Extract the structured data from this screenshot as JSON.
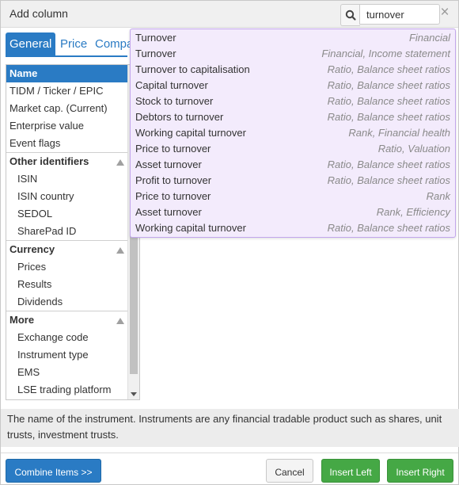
{
  "dialog": {
    "title": "Add column",
    "close_symbol": "×"
  },
  "search": {
    "value": "turnover"
  },
  "tabs": [
    {
      "label": "General",
      "active": true
    },
    {
      "label": "Price",
      "active": false
    },
    {
      "label": "Compa",
      "active": false
    }
  ],
  "list": {
    "rows": [
      {
        "label": "Name",
        "kind": "item",
        "selected": true
      },
      {
        "label": "TIDM / Ticker / EPIC",
        "kind": "item"
      },
      {
        "label": "Market cap. (Current)",
        "kind": "item"
      },
      {
        "label": "Enterprise value",
        "kind": "item"
      },
      {
        "label": "Event flags",
        "kind": "item"
      },
      {
        "label": "Other identifiers",
        "kind": "group"
      },
      {
        "label": "ISIN",
        "kind": "sub"
      },
      {
        "label": "ISIN country",
        "kind": "sub"
      },
      {
        "label": "SEDOL",
        "kind": "sub"
      },
      {
        "label": "SharePad ID",
        "kind": "sub"
      },
      {
        "label": "Currency",
        "kind": "group"
      },
      {
        "label": "Prices",
        "kind": "sub"
      },
      {
        "label": "Results",
        "kind": "sub"
      },
      {
        "label": "Dividends",
        "kind": "sub"
      },
      {
        "label": "More",
        "kind": "group"
      },
      {
        "label": "Exchange code",
        "kind": "sub"
      },
      {
        "label": "Instrument type",
        "kind": "sub"
      },
      {
        "label": "EMS",
        "kind": "sub"
      },
      {
        "label": "LSE trading platform",
        "kind": "sub"
      }
    ]
  },
  "dropdown": {
    "results": [
      {
        "name": "Turnover",
        "category": "Financial"
      },
      {
        "name": "Turnover",
        "category": "Financial, Income statement"
      },
      {
        "name": "Turnover to capitalisation",
        "category": "Ratio, Balance sheet ratios"
      },
      {
        "name": "Capital turnover",
        "category": "Ratio, Balance sheet ratios"
      },
      {
        "name": "Stock to turnover",
        "category": "Ratio, Balance sheet ratios"
      },
      {
        "name": "Debtors to turnover",
        "category": "Ratio, Balance sheet ratios"
      },
      {
        "name": "Working capital turnover",
        "category": "Rank, Financial health"
      },
      {
        "name": "Price to turnover",
        "category": "Ratio, Valuation"
      },
      {
        "name": "Asset turnover",
        "category": "Ratio, Balance sheet ratios"
      },
      {
        "name": "Profit to turnover",
        "category": "Ratio, Balance sheet ratios"
      },
      {
        "name": "Price to turnover",
        "category": "Rank"
      },
      {
        "name": "Asset turnover",
        "category": "Rank, Efficiency"
      },
      {
        "name": "Working capital turnover",
        "category": "Ratio, Balance sheet ratios"
      }
    ]
  },
  "description": "The name of the instrument. Instruments are any financial tradable product such as shares, unit trusts, investment trusts.",
  "footer": {
    "combine_label": "Combine Items >>",
    "cancel_label": "Cancel",
    "insert_left_label": "Insert Left",
    "insert_right_label": "Insert Right"
  },
  "colors": {
    "accent": "#2a7bc4",
    "insert": "#45a845",
    "dropdown_bg": "#f3ebfc",
    "dropdown_border": "#c2a6ec"
  },
  "icons": {
    "search": "search-icon",
    "close": "close-icon",
    "collapse": "collapse-triangle-icon",
    "scroll_down": "scroll-down-arrow-icon"
  }
}
